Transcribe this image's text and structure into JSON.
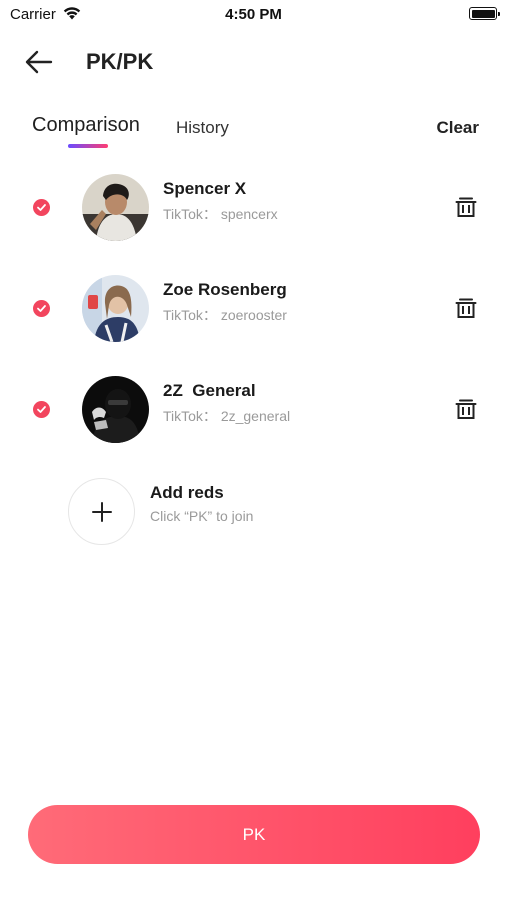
{
  "status_bar": {
    "carrier": "Carrier",
    "time": "4:50 PM"
  },
  "header": {
    "title": "PK/PK"
  },
  "tabs": {
    "comparison": "Comparison",
    "history": "History",
    "clear": "Clear"
  },
  "items": [
    {
      "name": "Spencer X",
      "handle": "TikTok： spencerx",
      "selected": true
    },
    {
      "name": "Zoe Rosenberg",
      "handle": "TikTok： zoerooster",
      "selected": true
    },
    {
      "name": "2Z  General",
      "handle": "TikTok： 2z_general",
      "selected": true
    }
  ],
  "add": {
    "title": "Add reds",
    "subtitle": "Click “PK” to join"
  },
  "pk_button": {
    "label": "PK"
  },
  "colors": {
    "accent": "#f2455e",
    "button_start": "#ff6b78",
    "button_end": "#ff3f5e",
    "tab_indicator_start": "#6a4cff",
    "tab_indicator_end": "#ff3d72"
  }
}
